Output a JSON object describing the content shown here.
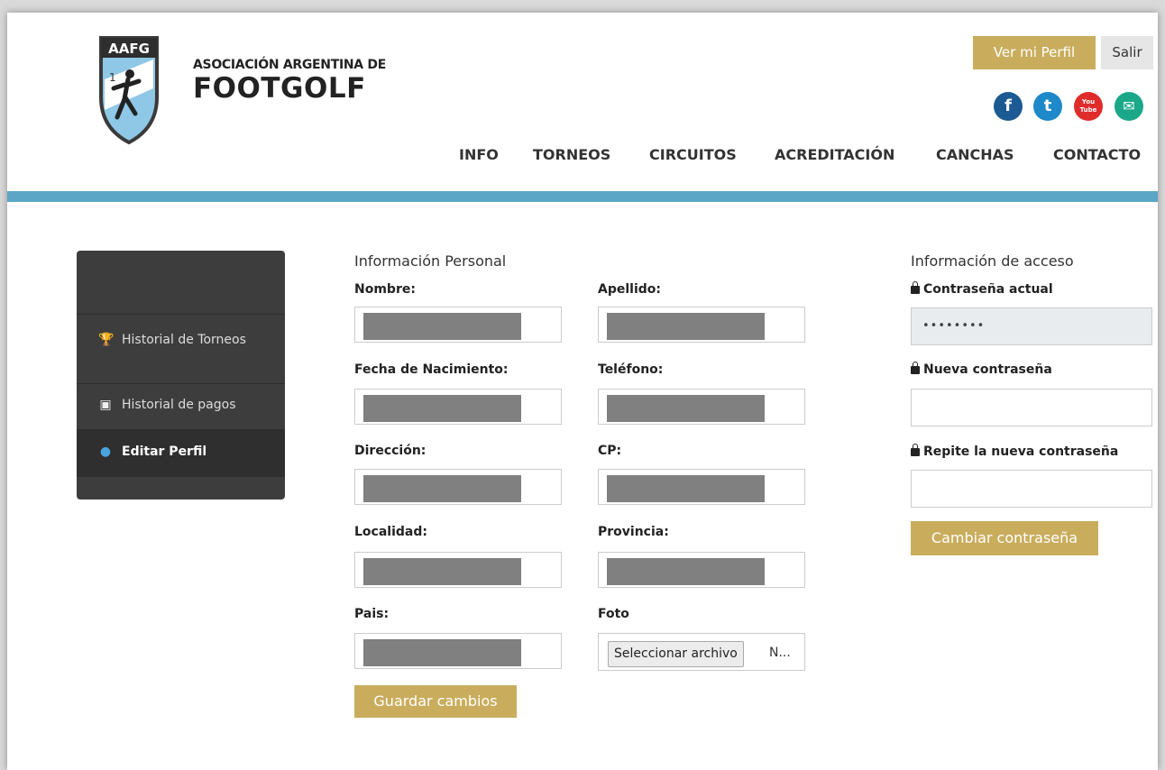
{
  "header": {
    "logo_abbr": "AAFG",
    "brand_line1": "ASOCIACIÓN ARGENTINA DE",
    "brand_line2": "FOOTGOLF",
    "ver_perfil": "Ver mi Perfil",
    "salir": "Salir",
    "social": [
      {
        "icon": "facebook-icon",
        "glyph": "f",
        "color": "#3b5998"
      },
      {
        "icon": "twitter-icon",
        "glyph": "t",
        "color": "#1da1f2"
      },
      {
        "icon": "youtube-icon",
        "glyph": "You Tube",
        "color": "#e52d27"
      },
      {
        "icon": "email-icon",
        "glyph": "✉",
        "color": "#1abc9c"
      }
    ],
    "nav": [
      "INFO",
      "TORNEOS",
      "CIRCUITOS",
      "ACREDITACIÓN",
      "CANCHAS",
      "CONTACTO"
    ]
  },
  "sidebar": {
    "items": [
      {
        "label": "Historial de Torneos",
        "icon": "trophy-icon"
      },
      {
        "label": "Historial de pagos",
        "icon": "money-icon"
      },
      {
        "label": "Editar Perfil",
        "icon": "user-icon"
      }
    ]
  },
  "personal": {
    "title": "Información Personal",
    "nombre": "Nombre:",
    "apellido": "Apellido:",
    "fecha": "Fecha de Nacimiento:",
    "telefono": "Teléfono:",
    "direccion": "Dirección:",
    "cp": "CP:",
    "localidad": "Localidad:",
    "provincia": "Provincia:",
    "pais": "Pais:",
    "foto": "Foto",
    "file_button": "Seleccionar archivo",
    "file_name": "N...",
    "save": "Guardar cambios"
  },
  "access": {
    "title": "Información de acceso",
    "current": "Contraseña actual",
    "current_value": "••••••••",
    "new": "Nueva contraseña",
    "repeat": "Repite la nueva contraseña",
    "change": "Cambiar contraseña"
  },
  "colors": {
    "accent": "#c9ad5d",
    "bar": "#5ba6c6",
    "sidebar": "#3d3d3d"
  }
}
